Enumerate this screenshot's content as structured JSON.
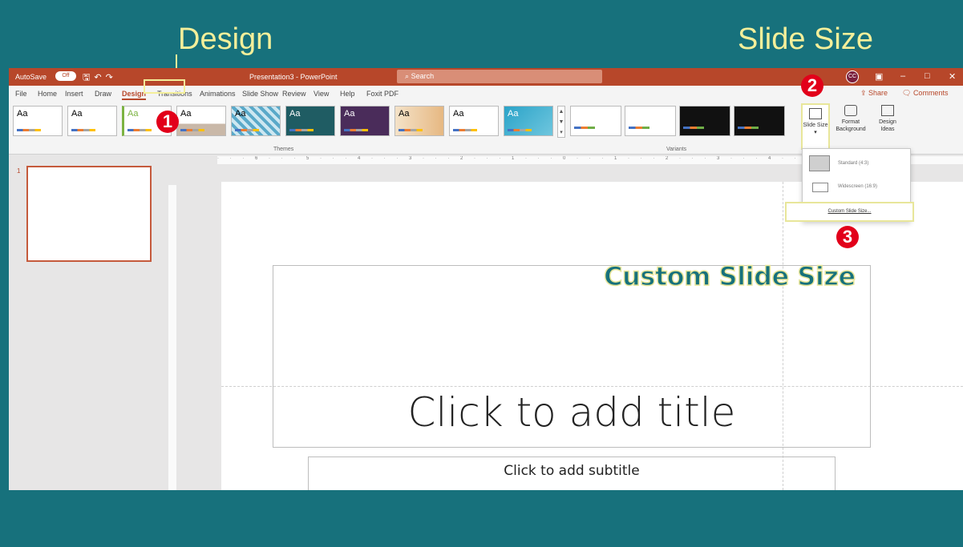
{
  "annotations": {
    "design_label": "Design",
    "slide_size_label": "Slide Size",
    "custom_label": "Custom Slide Size",
    "step1": "1",
    "step2": "2",
    "step3": "3"
  },
  "titlebar": {
    "autosave": "AutoSave",
    "autosave_state": "Off",
    "doc_title": "Presentation3 - PowerPoint",
    "search_placeholder": "Search",
    "avatar": "CC"
  },
  "tabs": [
    "File",
    "Home",
    "Insert",
    "Draw",
    "Design",
    "Transitions",
    "Animations",
    "Slide Show",
    "Review",
    "View",
    "Help",
    "Foxit PDF"
  ],
  "active_tab": "Design",
  "share": "Share",
  "comments": "Comments",
  "ribbon": {
    "theme_sample": "Aa",
    "themes_group": "Themes",
    "variants_group": "Variants",
    "slide_size_btn": "Slide Size",
    "format_bg_btn": "Format Background",
    "design_ideas_btn": "Design Ideas"
  },
  "dropdown": {
    "standard": "Standard (4:3)",
    "widescreen": "Widescreen (16:9)",
    "custom": "Custom Slide Size..."
  },
  "slide": {
    "number": "1",
    "title_placeholder": "Click to add title",
    "subtitle_placeholder": "Click to add subtitle"
  },
  "colors": {
    "frame": "#17717c",
    "powerpoint_accent": "#b7472a",
    "annotation": "#f4ef9a",
    "step_badge": "#e2001a"
  }
}
